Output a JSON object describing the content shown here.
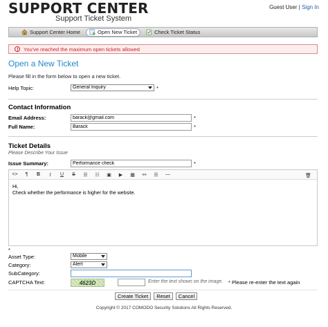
{
  "header": {
    "title": "SUPPORT CENTER",
    "subtitle": "Support Ticket System",
    "user_label": "Guest User",
    "separator": "|",
    "sign_in": "Sign In"
  },
  "nav": {
    "items": [
      {
        "label": "Support Center Home",
        "icon": "home-icon"
      },
      {
        "label": "Open New Ticket",
        "icon": "new-ticket-icon",
        "active": true
      },
      {
        "label": "Check Ticket Status",
        "icon": "ticket-status-icon"
      }
    ]
  },
  "alert": {
    "message": "You've reached the maximum open tickets allowed",
    "color": "#c2232f"
  },
  "page": {
    "title": "Open a New Ticket",
    "intro": "Please fill in the form below to open a new ticket."
  },
  "help_topic": {
    "label": "Help Topic:",
    "value": "General Inquiry",
    "required": "*"
  },
  "contact": {
    "heading": "Contact Information",
    "email_label": "Email Address:",
    "email_value": "barack@gmail.com",
    "name_label": "Full Name:",
    "name_value": "Barack",
    "required": "*"
  },
  "ticket": {
    "heading": "Ticket Details",
    "description": "Please Describe Your Issue",
    "summary_label": "Issue Summary:",
    "summary_value": "Performance check",
    "required": "*",
    "toolbar": {
      "source": "<>",
      "paragraph": "¶",
      "bold": "B",
      "italic": "I",
      "underline": "U",
      "strike": "S",
      "unordered_list": "☰",
      "ordered_list": "☷",
      "image": "▣",
      "video": "▶",
      "table": "▦",
      "link": "⚯",
      "align": "☰",
      "hr": "—",
      "trash": "🗑"
    },
    "body_line1": "Hi,",
    "body_line2": "Check whether the performance is higher for the website.",
    "body_required": "*"
  },
  "asset": {
    "label": "Asset Type:",
    "value": "Mobile"
  },
  "category": {
    "label": "Category:",
    "value": "Alert"
  },
  "subcategory": {
    "label": "SubCategory:",
    "value": ""
  },
  "captcha": {
    "label": "CAPTCHA Text:",
    "code": "4623D",
    "value": "",
    "hint": "Enter the text shown on the image.",
    "note": "* Please re-enter the text again"
  },
  "buttons": {
    "create": "Create Ticket",
    "reset": "Reset",
    "cancel": "Cancel"
  },
  "footer": "Copyright © 2017 COMODO Security Solutions All Rights Reserved."
}
